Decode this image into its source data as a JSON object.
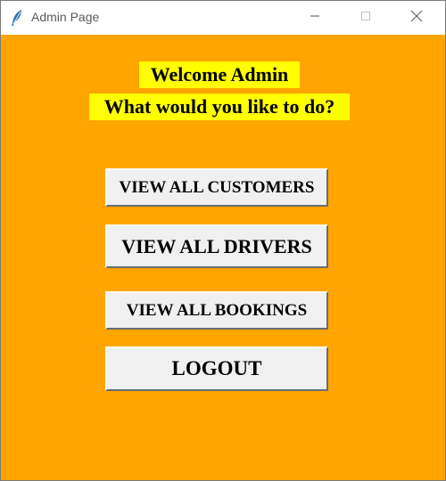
{
  "window": {
    "title": "Admin Page",
    "icon": "feather-icon",
    "controls": [
      "minimize-icon",
      "maximize-icon",
      "close-icon"
    ]
  },
  "main": {
    "welcome": "Welcome Admin",
    "question": "What would you like to do?",
    "buttons": {
      "customers": "VIEW ALL CUSTOMERS",
      "drivers": "VIEW ALL DRIVERS",
      "bookings": "VIEW ALL BOOKINGS",
      "logout": "LOGOUT"
    }
  },
  "colors": {
    "background": "#ffa500",
    "label_highlight": "#ffff00",
    "button_face": "#f0f0f0"
  }
}
